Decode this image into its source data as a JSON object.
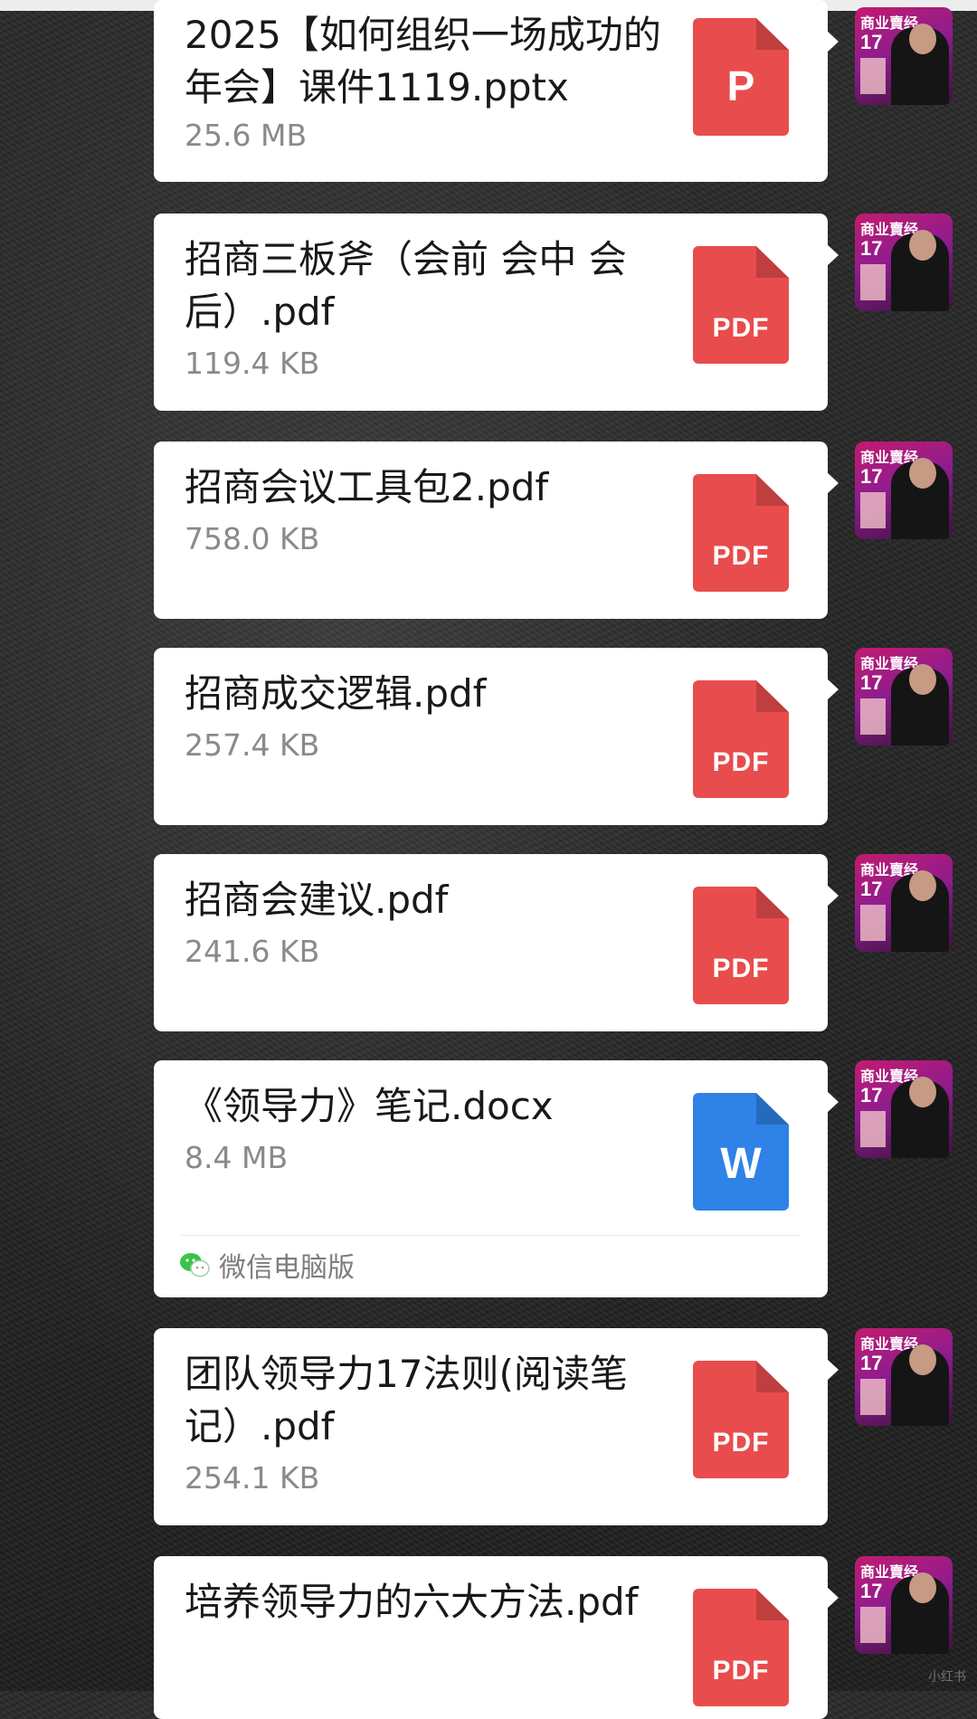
{
  "messages": [
    {
      "name": "2025【如何组织一场成功的年会】课件1119.pptx",
      "size": "25.6 MB",
      "type": "ppt",
      "icon_label": "P"
    },
    {
      "name": "招商三板斧（会前 会中 会后）.pdf",
      "size": "119.4 KB",
      "type": "pdf",
      "icon_label": "PDF"
    },
    {
      "name": "招商会议工具包2.pdf",
      "size": "758.0 KB",
      "type": "pdf",
      "icon_label": "PDF"
    },
    {
      "name": "招商成交逻辑.pdf",
      "size": "257.4 KB",
      "type": "pdf",
      "icon_label": "PDF"
    },
    {
      "name": "招商会建议.pdf",
      "size": "241.6 KB",
      "type": "pdf",
      "icon_label": "PDF"
    },
    {
      "name": "《领导力》笔记.docx",
      "size": "8.4 MB",
      "type": "doc",
      "icon_label": "W",
      "source": "微信电脑版"
    },
    {
      "name": "团队领导力17法则(阅读笔记）.pdf",
      "size": "254.1 KB",
      "type": "pdf",
      "icon_label": "PDF"
    },
    {
      "name": "培养领导力的六大方法.pdf",
      "size": "",
      "type": "pdf",
      "icon_label": "PDF"
    }
  ],
  "avatar": {
    "title": "商业賣经",
    "number": "17"
  },
  "colors": {
    "pdf": "#e94c4c",
    "ppt": "#e94c4c",
    "doc": "#2f82e6",
    "bubble": "#ffffff"
  },
  "icons": {
    "pdf": "pdf-file-icon",
    "ppt": "ppt-file-icon",
    "doc": "word-file-icon",
    "wechat": "wechat-icon"
  },
  "watermark": "小红书"
}
